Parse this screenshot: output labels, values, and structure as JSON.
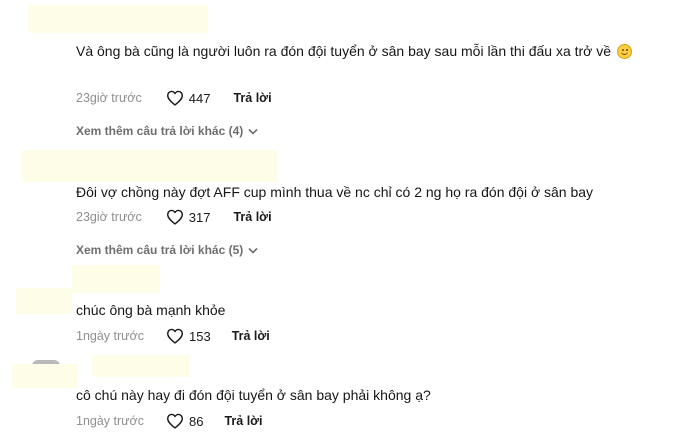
{
  "comments": [
    {
      "text": "Và ông bà cũng là người luôn ra đón đội tuyển ở sân bay sau mỗi lần thi đấu xa trở về",
      "emoji": "smiling-face",
      "time": "23giờ trước",
      "likes": "447",
      "reply_label": "Trả lời",
      "more_replies": "Xem thêm câu trả lời khác (4)"
    },
    {
      "text": "Đôi vợ chồng này đợt AFF cup mình thua về nc chỉ có 2 ng họ ra đón đội ở sân bay",
      "time": "23giờ trước",
      "likes": "317",
      "reply_label": "Trả lời",
      "more_replies": "Xem thêm câu trả lời khác (5)"
    },
    {
      "text": "chúc ông bà mạnh khỏe",
      "time": "1ngày trước",
      "likes": "153",
      "reply_label": "Trả lời"
    },
    {
      "text": "cô chú này hay đi đón đội tuyển ở sân bay phải không ạ?",
      "time": "1ngày trước",
      "likes": "86",
      "reply_label": "Trả lời"
    }
  ],
  "icons": {
    "like": "heart-outline-icon",
    "expand": "chevron-down-icon"
  },
  "colors": {
    "redaction": "#fdfde8",
    "muted_text": "#8f8f8f",
    "more_link": "#6e6e6e"
  }
}
